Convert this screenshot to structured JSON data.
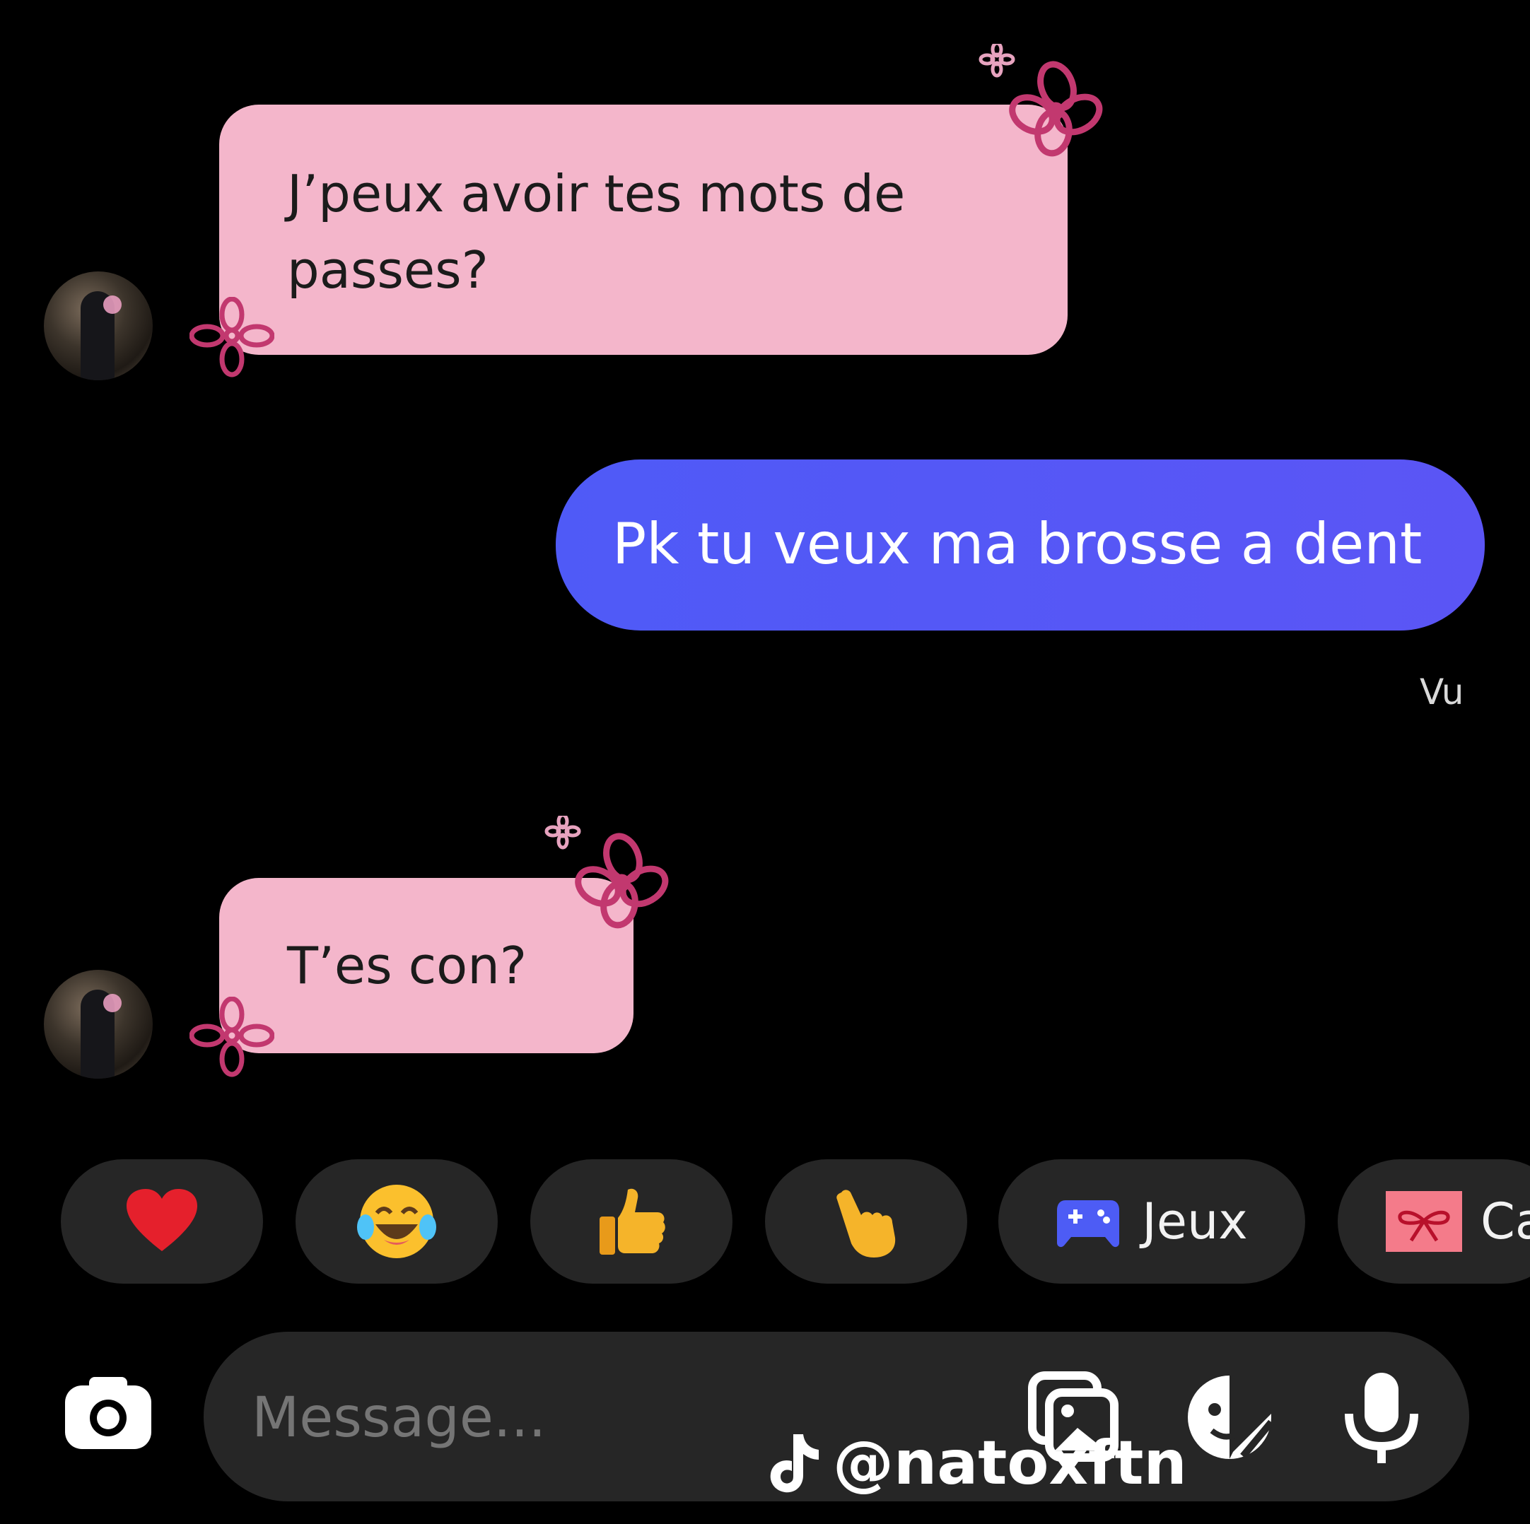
{
  "messages": [
    {
      "from": "them",
      "text_line1": "J’peux avoir tes mots de",
      "text_line2": "passes?"
    },
    {
      "from": "me",
      "text": "Pk tu veux ma brosse a dent",
      "status": "Vu"
    },
    {
      "from": "them",
      "text": "T’es con?"
    }
  ],
  "quick_actions": {
    "heart": "heart-emoji",
    "laugh": "tears-of-joy-emoji",
    "thumbs": "thumbs-up-emoji",
    "point": "pointing-hand-emoji",
    "games_label": "Jeux",
    "gift_label": "Ca"
  },
  "composer": {
    "placeholder": "Message..."
  },
  "watermark": "@natoxftn",
  "colors": {
    "incoming_bubble": "#f4b6cb",
    "outgoing_bubble": "#4f5af7",
    "flower": "#c2386f",
    "chip_bg": "#262626"
  }
}
